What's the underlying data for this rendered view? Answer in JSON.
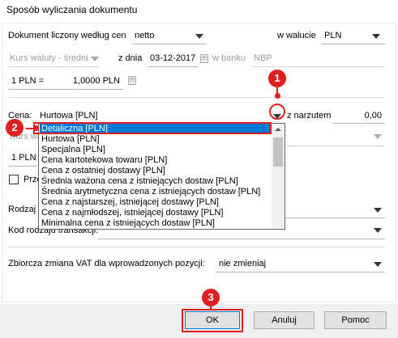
{
  "window": {
    "title": "Sposób wyliczania dokumentu"
  },
  "form": {
    "calc_by_label": "Dokument liczony według cen",
    "calc_by_value": "netto",
    "currency_label": "w walucie",
    "currency_value": "PLN",
    "rate_type": "Kurs waluty - średni",
    "rate_date_label": "z dnia",
    "rate_date_value": "03-12-2017",
    "bank_label": "w banku",
    "bank_value": "NBP",
    "rate_lhs": "1 PLN =",
    "rate_rhs": "1,0000 PLN",
    "price_label": "Cena:",
    "price_value": "Hurtowa [PLN]",
    "markup_label": "z narzutem",
    "markup_value": "0,00",
    "partial_row_label": "Kurs wa",
    "partial_rate_label": "1 PLN =",
    "partial_checkbox_label": "Prze",
    "type_label": "Rodzaj",
    "type_code_label": "Kod rodzaju transakcji:",
    "vat_change_label": "Zbiorcza zmiana VAT dla wprowadzonych pozycji:",
    "vat_change_value": "nie zmieniaj"
  },
  "dropdown": {
    "options": [
      "Detaliczna [PLN]",
      "Hurtowa [PLN]",
      "Specjalna [PLN]",
      "Cena kartotekowa towaru [PLN]",
      "Cena z ostatniej dostawy [PLN]",
      "Średnia ważona cena z istniejących dostaw [PLN]",
      "Średnia arytmetyczna cena z istniejących dostaw [PLN]",
      "Cena z najstarszej, istniejącej dostawy [PLN]",
      "Cena z najmłodszej, istniejącej dostawy [PLN]",
      "Minimalna cena z istniejących dostaw [PLN]"
    ],
    "selected": "Detaliczna [PLN]"
  },
  "buttons": {
    "ok": "OK",
    "cancel": "Anuluj",
    "help": "Pomoc"
  },
  "annotations": {
    "step1": "1",
    "step2": "2",
    "step3": "3",
    "color": "#e02020"
  },
  "colors": {
    "selection": "#0078d7",
    "footer_bg": "#f0f0f0"
  }
}
